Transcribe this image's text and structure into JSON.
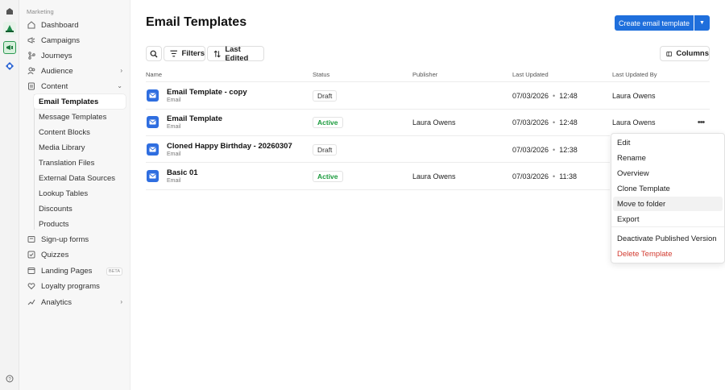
{
  "sidebar": {
    "section_label": "Marketing",
    "items": [
      {
        "label": "Dashboard"
      },
      {
        "label": "Campaigns"
      },
      {
        "label": "Journeys"
      },
      {
        "label": "Audience"
      },
      {
        "label": "Content"
      }
    ],
    "content_sub": [
      {
        "label": "Email Templates"
      },
      {
        "label": "Message Templates"
      },
      {
        "label": "Content Blocks"
      },
      {
        "label": "Media Library"
      },
      {
        "label": "Translation Files"
      },
      {
        "label": "External Data Sources"
      },
      {
        "label": "Lookup Tables"
      },
      {
        "label": "Discounts"
      },
      {
        "label": "Products"
      }
    ],
    "bottom_items": [
      {
        "label": "Sign-up forms"
      },
      {
        "label": "Quizzes"
      },
      {
        "label": "Landing Pages",
        "badge": "BETA"
      },
      {
        "label": "Loyalty programs"
      },
      {
        "label": "Analytics"
      }
    ]
  },
  "header": {
    "title": "Email Templates",
    "create_label": "Create email template"
  },
  "toolbar": {
    "filters_label": "Filters",
    "sort_label": "Last Edited",
    "columns_label": "Columns"
  },
  "table": {
    "columns": [
      "Name",
      "Status",
      "Publisher",
      "Last Updated",
      "Last Updated By"
    ],
    "rows": [
      {
        "name": "Email Template - copy",
        "type": "Email",
        "status": "Draft",
        "publisher": "",
        "date": "07/03/2026",
        "time": "12:48",
        "updated_by": "Laura Owens"
      },
      {
        "name": "Email Template",
        "type": "Email",
        "status": "Active",
        "publisher": "Laura Owens",
        "date": "07/03/2026",
        "time": "12:48",
        "updated_by": "Laura Owens"
      },
      {
        "name": "Cloned Happy Birthday - 20260307",
        "type": "Email",
        "status": "Draft",
        "publisher": "",
        "date": "07/03/2026",
        "time": "12:38",
        "updated_by": ""
      },
      {
        "name": "Basic 01",
        "type": "Email",
        "status": "Active",
        "publisher": "Laura Owens",
        "date": "07/03/2026",
        "time": "11:38",
        "updated_by": ""
      }
    ]
  },
  "context_menu": {
    "items": [
      {
        "label": "Edit"
      },
      {
        "label": "Rename"
      },
      {
        "label": "Overview"
      },
      {
        "label": "Clone Template"
      },
      {
        "label": "Move to folder"
      },
      {
        "label": "Export"
      },
      {
        "label": "Deactivate Published Version"
      },
      {
        "label": "Delete Template"
      }
    ]
  },
  "icons": {
    "email": "envelope-icon",
    "search": "search-icon",
    "filter": "filter-icon",
    "sort": "sort-icon",
    "columns": "columns-icon",
    "more": "more-horizontal-icon"
  },
  "colors": {
    "accent": "#1f6fdc",
    "active": "#1a9a3c",
    "danger": "#d23a2f"
  }
}
